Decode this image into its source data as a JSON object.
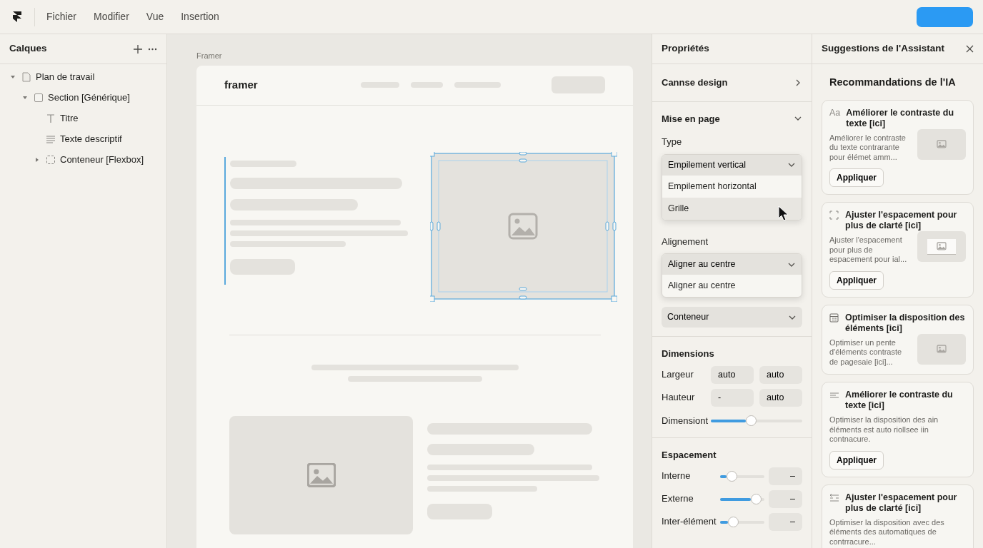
{
  "menu": [
    {
      "label": "Fichier"
    },
    {
      "label": "Modifier"
    },
    {
      "label": "Vue"
    },
    {
      "label": "Insertion"
    }
  ],
  "layers": {
    "title": "Calques",
    "items": [
      {
        "label": "Plan de travail",
        "kind": "page",
        "expanded": true,
        "children": [
          {
            "label": "Section [Générique]",
            "kind": "frame",
            "expanded": true,
            "children": [
              {
                "label": "Titre",
                "kind": "text"
              },
              {
                "label": "Texte descriptif",
                "kind": "paragraph"
              },
              {
                "label": "Conteneur [Flexbox]",
                "kind": "container",
                "expanded": false
              }
            ]
          }
        ]
      }
    ]
  },
  "canvas": {
    "frame_label": "Framer",
    "logo": "framer"
  },
  "properties": {
    "title": "Propriétés",
    "design": {
      "title": "Cannse design",
      "expanded": false
    },
    "layout": {
      "title": "Mise en page",
      "expanded": true,
      "type_label": "Type",
      "type_select": {
        "value": "Empilement vertical",
        "options": [
          {
            "label": "Empilement horizontal",
            "hovered": false
          },
          {
            "label": "Grille",
            "hovered": true
          }
        ]
      },
      "align_label": "Alignement",
      "align_select": {
        "value": "Aligner au centre",
        "options": [
          {
            "label": "Aligner au centre",
            "hovered": false
          }
        ]
      },
      "container_select": {
        "value": "Conteneur"
      }
    },
    "dimensions": {
      "title": "Dimensions",
      "rows": [
        {
          "label": "Largeur",
          "values": [
            "auto",
            "auto"
          ]
        },
        {
          "label": "Hauteur",
          "values": [
            "-",
            "auto"
          ]
        }
      ],
      "slider": {
        "label": "Dimensiont",
        "level": 0.38
      }
    },
    "spacing": {
      "title": "Espacement",
      "rows": [
        {
          "label": "Interne",
          "level": 0.15,
          "value": "–"
        },
        {
          "label": "Externe",
          "level": 0.69,
          "value": "–"
        },
        {
          "label": "Inter-élément",
          "level": 0.18,
          "value": "–"
        }
      ]
    }
  },
  "assistant": {
    "title": "Suggestions de l'Assistant",
    "heading": "Recommandations de l'IA",
    "cards": [
      {
        "icon": {
          "kind": "glyph",
          "text": "Aa"
        },
        "title": "Améliorer le contraste du texte [ici]",
        "body": "Améliorer le contraste du texte contrarante pour élémet amm...",
        "thumbnail": {
          "kind": "plain"
        },
        "action": "Appliquer"
      },
      {
        "icon": {
          "kind": "frame"
        },
        "title": "Ajuster l'espacement pour plus de clarté [ici]",
        "body": "Ajuster l'espacement pour plus de espacement pour ial...",
        "thumbnail": {
          "kind": "framed"
        },
        "action": "Appliquer"
      },
      {
        "icon": {
          "kind": "grid"
        },
        "title": "Optimiser la disposition des éléments [ici]",
        "body": "Optimiser un pente d'éléments contraste de pagesaie [ici]...",
        "thumbnail": {
          "kind": "plain"
        }
      },
      {
        "icon": {
          "kind": "lines"
        },
        "title": "Améliorer le contraste du texte [ici]",
        "body": "Optimiser la disposition des ain éléments est auto riollsee iin contnacure.",
        "action": "Appliquer"
      },
      {
        "icon": {
          "kind": "spacing"
        },
        "title": "Ajuster l'espacement pour plus de clarté [ici]",
        "body": "Optimiser la disposition avec des éléments des automatiques de contrracure..."
      }
    ]
  }
}
